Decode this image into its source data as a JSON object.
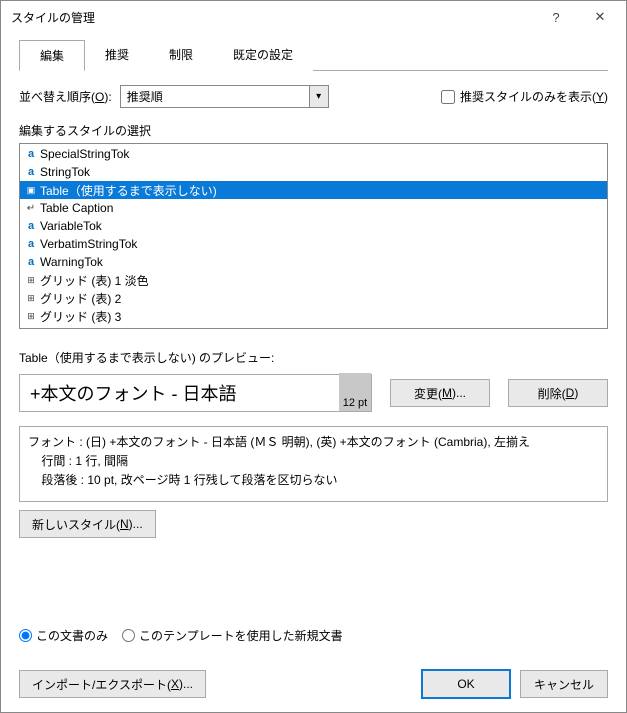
{
  "title": "スタイルの管理",
  "help_icon": "?",
  "close_icon": "✕",
  "tabs": [
    "編集",
    "推奨",
    "制限",
    "既定の設定"
  ],
  "sort": {
    "label_pre": "並べ替え順序(",
    "akey": "O",
    "label_post": "):",
    "value": "推奨順"
  },
  "show_recommended": {
    "pre": "推奨スタイルのみを表示(",
    "akey": "Y",
    "post": ")"
  },
  "list_label": "編集するスタイルの選択",
  "styles": [
    {
      "icon": "a",
      "label": "SpecialStringTok"
    },
    {
      "icon": "a",
      "label": "StringTok"
    },
    {
      "icon": "p",
      "label": "Table（使用するまで表示しない)",
      "selected": true
    },
    {
      "icon": "arrow",
      "label": "Table Caption"
    },
    {
      "icon": "a",
      "label": "VariableTok"
    },
    {
      "icon": "a",
      "label": "VerbatimStringTok"
    },
    {
      "icon": "a",
      "label": "WarningTok"
    },
    {
      "icon": "box",
      "label": "グリッド (表) 1 淡色"
    },
    {
      "icon": "box",
      "label": "グリッド (表) 2"
    },
    {
      "icon": "box",
      "label": "グリッド (表) 3"
    }
  ],
  "preview_label": "Table（使用するまで表示しない) のプレビュー:",
  "preview_font": "+本文のフォント - 日本語",
  "preview_pt": "12 pt",
  "buttons": {
    "modify_pre": "変更(",
    "modify_key": "M",
    "modify_post": ")...",
    "delete_pre": "削除(",
    "delete_key": "D",
    "delete_post": ")",
    "newstyle_pre": "新しいスタイル(",
    "newstyle_key": "N",
    "newstyle_post": ")...",
    "import_pre": "インポート/エクスポート(",
    "import_key": "X",
    "import_post": ")...",
    "ok": "OK",
    "cancel": "キャンセル"
  },
  "desc": {
    "l1": "フォント : (日) +本文のフォント - 日本語 (ＭＳ 明朝), (英) +本文のフォント (Cambria), 左揃え",
    "l2": "    行間 :  1 行, 間隔",
    "l3": "    段落後 :  10 pt, 改ページ時 1 行残して段落を区切らない"
  },
  "radios": {
    "only_doc": "この文書のみ",
    "template": "このテンプレートを使用した新規文書"
  }
}
